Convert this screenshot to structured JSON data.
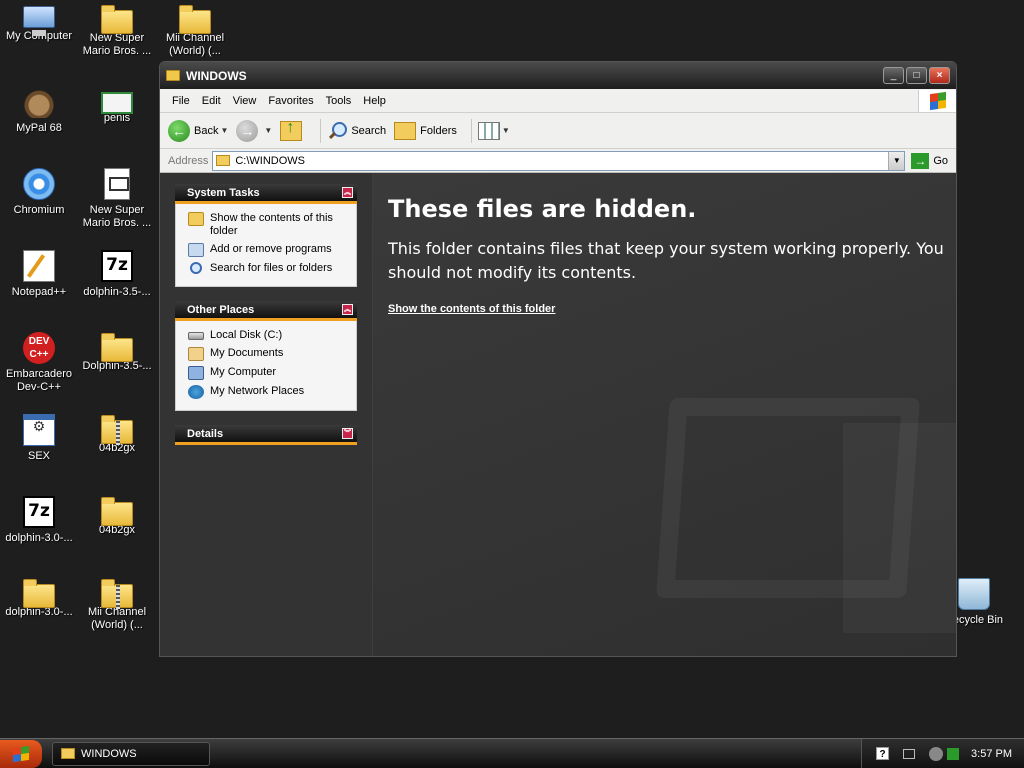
{
  "desktop": {
    "icons": [
      {
        "label": "My Computer"
      },
      {
        "label": "New Super Mario Bros. ..."
      },
      {
        "label": "Mii Channel (World) (..."
      },
      {
        "label": "MyPal 68"
      },
      {
        "label": "penis"
      },
      {
        "label": "Chromium"
      },
      {
        "label": "New Super Mario Bros. ..."
      },
      {
        "label": "Notepad++"
      },
      {
        "label": "dolphin-3.5-..."
      },
      {
        "label": "Embarcadero Dev-C++"
      },
      {
        "label": "Dolphin-3.5-..."
      },
      {
        "label": "SEX"
      },
      {
        "label": "04b2gx"
      },
      {
        "label": "dolphin-3.0-..."
      },
      {
        "label": "04b2gx"
      },
      {
        "label": "dolphin-3.0-..."
      },
      {
        "label": "Mii Channel (World) (..."
      },
      {
        "label": "Recycle Bin"
      }
    ]
  },
  "window": {
    "title": "WINDOWS",
    "controls": {
      "minimize": "_",
      "maximize": "□",
      "close": "×"
    }
  },
  "menu": {
    "items": [
      "File",
      "Edit",
      "View",
      "Favorites",
      "Tools",
      "Help"
    ]
  },
  "toolbar": {
    "back": "Back",
    "search": "Search",
    "folders": "Folders"
  },
  "address": {
    "label": "Address",
    "value": "C:\\WINDOWS",
    "go": "Go"
  },
  "sidebar": {
    "system_tasks": {
      "title": "System Tasks",
      "items": [
        "Show the contents of this folder",
        "Add or remove programs",
        "Search for files or folders"
      ]
    },
    "other_places": {
      "title": "Other Places",
      "items": [
        "Local Disk (C:)",
        "My Documents",
        "My Computer",
        "My Network Places"
      ]
    },
    "details": {
      "title": "Details"
    }
  },
  "main": {
    "heading": "These files are hidden.",
    "message": "This folder contains files that keep your system working properly. You should not modify its contents.",
    "link": "Show the contents of this folder"
  },
  "taskbar": {
    "task_label": "WINDOWS",
    "clock": "3:57 PM"
  }
}
